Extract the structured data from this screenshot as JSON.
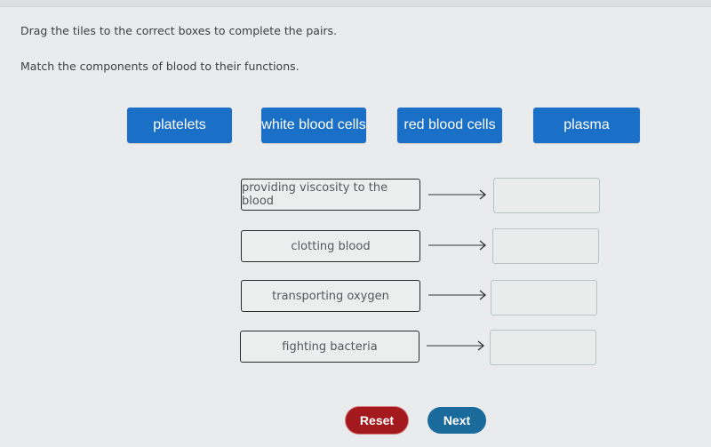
{
  "instructions": {
    "line1": "Drag the tiles to the correct boxes to complete the pairs.",
    "line2": "Match the components of blood to their functions."
  },
  "tiles": [
    {
      "label": "platelets"
    },
    {
      "label": "white blood cells"
    },
    {
      "label": "red blood cells"
    },
    {
      "label": "plasma"
    }
  ],
  "pairs": [
    {
      "function": "providing viscosity to the blood",
      "answer": ""
    },
    {
      "function": "clotting blood",
      "answer": ""
    },
    {
      "function": "transporting oxygen",
      "answer": ""
    },
    {
      "function": "fighting bacteria",
      "answer": ""
    }
  ],
  "buttons": {
    "reset": "Reset",
    "next": "Next"
  },
  "colors": {
    "tile": "#1a6fc6",
    "reset": "#a3191d",
    "next": "#1b6a9c"
  }
}
